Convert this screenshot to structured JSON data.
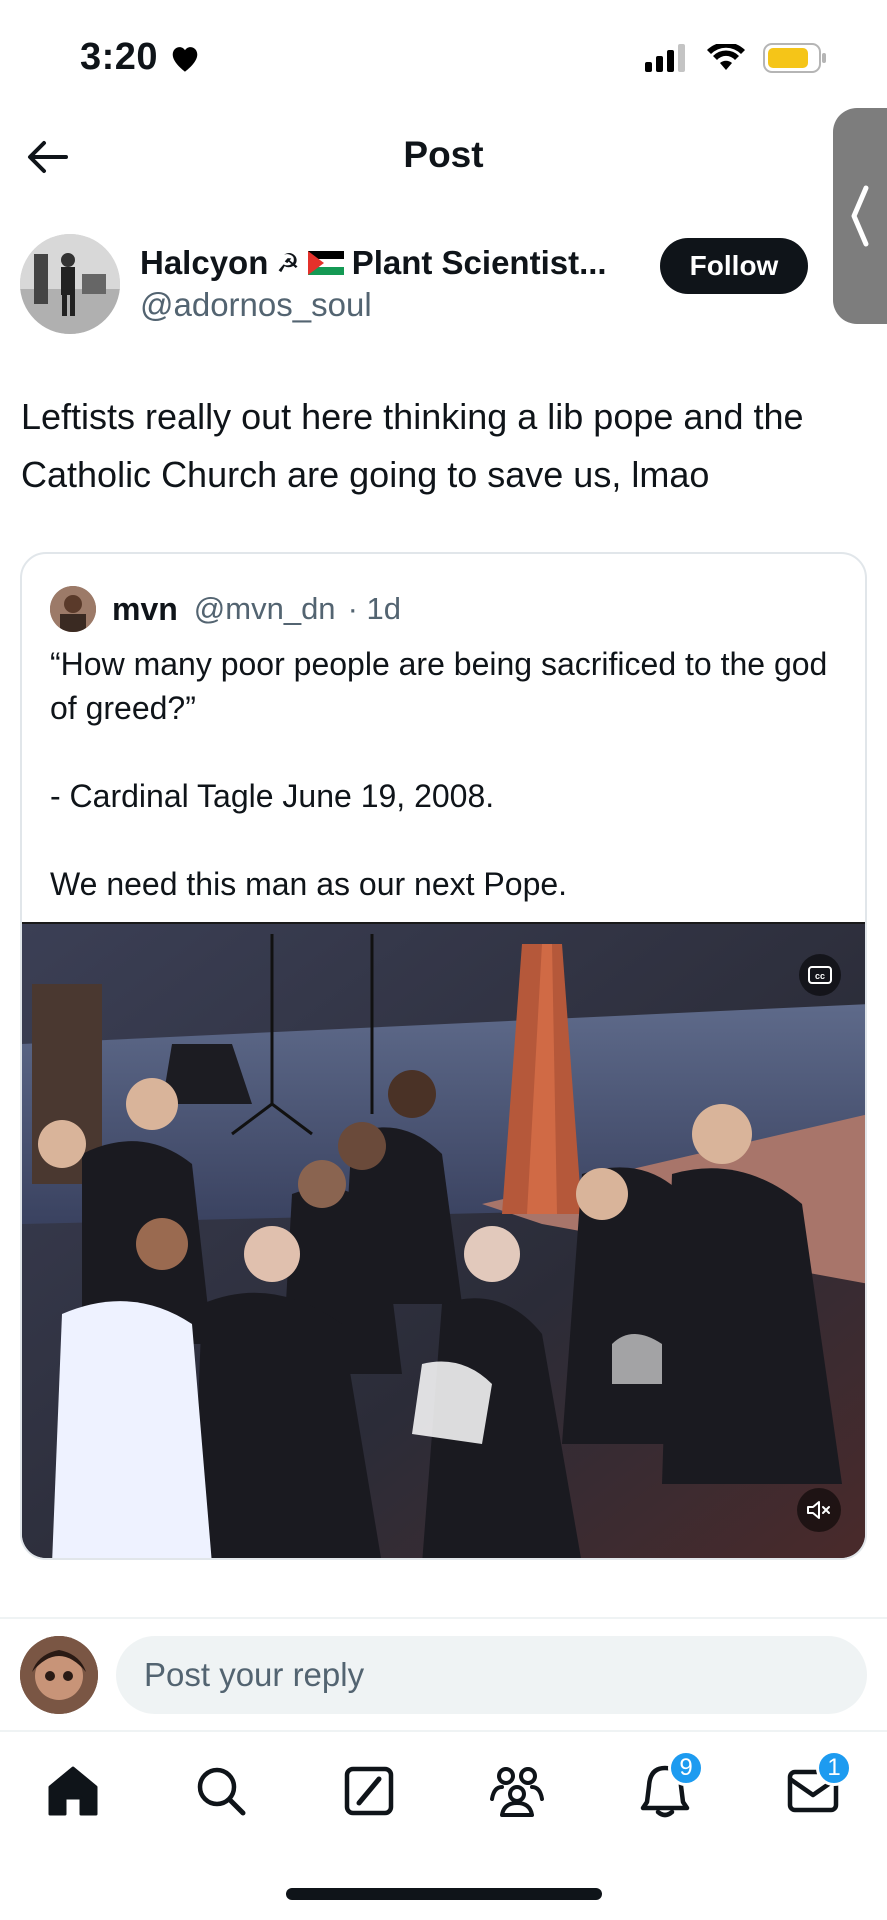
{
  "status_bar": {
    "time": "3:20"
  },
  "header": {
    "title": "Post"
  },
  "author": {
    "name": "Halcyon ☭ 🇵🇸 Plant Scientist...",
    "name_text": "Halcyon",
    "name_suffix": "Plant Scientist...",
    "handle": "@adornos_soul",
    "follow_label": "Follow"
  },
  "post": {
    "text": "Leftists really out here thinking a lib pope and the Catholic Church are going to save us, lmao"
  },
  "quote": {
    "name": "mvn",
    "handle": "@mvn_dn",
    "age": "· 1d",
    "text": "“How many poor people are being sacrificed to the god of greed?”\n\n- Cardinal Tagle June 19, 2008.\n\nWe need this man as our next Pope."
  },
  "reply": {
    "placeholder": "Post your reply"
  },
  "nav": {
    "items": [
      {
        "name": "home",
        "icon": "home-icon"
      },
      {
        "name": "search",
        "icon": "search-icon"
      },
      {
        "name": "grok",
        "icon": "grok-icon"
      },
      {
        "name": "communities",
        "icon": "communities-icon"
      },
      {
        "name": "notifications",
        "icon": "bell-icon",
        "badge": "9"
      },
      {
        "name": "messages",
        "icon": "mail-icon",
        "badge": "1"
      }
    ]
  },
  "colors": {
    "accent": "#1d9bf0",
    "text": "#0f1419",
    "secondary": "#536471"
  }
}
